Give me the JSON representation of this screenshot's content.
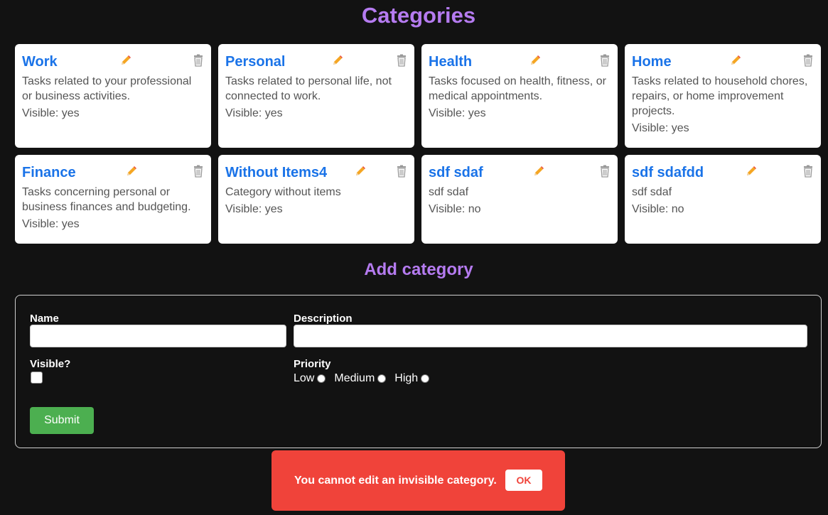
{
  "page": {
    "title": "Categories",
    "add_title": "Add category"
  },
  "colors": {
    "background": "#121212",
    "accent": "#b57bf0",
    "card_title": "#1a73e8",
    "submit": "#4caf50",
    "toast": "#f0433a"
  },
  "categories": [
    {
      "name": "Work",
      "description": "Tasks related to your professional or business activities.",
      "visible": "Visible: yes"
    },
    {
      "name": "Personal",
      "description": "Tasks related to personal life, not connected to work.",
      "visible": "Visible: yes"
    },
    {
      "name": "Health",
      "description": "Tasks focused on health, fitness, or medical appointments.",
      "visible": "Visible: yes"
    },
    {
      "name": "Home",
      "description": "Tasks related to household chores, repairs, or home improvement projects.",
      "visible": "Visible: yes"
    },
    {
      "name": "Finance",
      "description": "Tasks concerning personal or business finances and budgeting.",
      "visible": "Visible: yes"
    },
    {
      "name": "Without Items4",
      "description": "Category without items",
      "visible": "Visible: yes"
    },
    {
      "name": "sdf sdaf",
      "description": "sdf sdaf",
      "visible": "Visible: no"
    },
    {
      "name": "sdf sdafdd",
      "description": "sdf sdaf",
      "visible": "Visible: no"
    }
  ],
  "icons": {
    "edit": "pencil-icon",
    "delete": "trash-icon"
  },
  "form": {
    "name_label": "Name",
    "name_value": "",
    "description_label": "Description",
    "description_value": "",
    "visible_label": "Visible?",
    "visible_checked": false,
    "priority_label": "Priority",
    "priority_options": [
      "Low",
      "Medium",
      "High"
    ],
    "submit_label": "Submit"
  },
  "toast": {
    "message": "You cannot edit an invisible category.",
    "ok_label": "OK"
  }
}
